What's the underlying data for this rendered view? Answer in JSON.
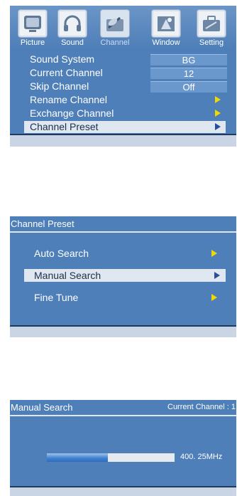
{
  "main_menu": {
    "tabs": [
      {
        "label": "Picture",
        "icon": "tv-icon"
      },
      {
        "label": "Sound",
        "icon": "headphones-icon"
      },
      {
        "label": "Channel",
        "icon": "satellite-dish-icon",
        "active": true
      },
      {
        "label": "Window",
        "icon": "window-icon"
      },
      {
        "label": "Setting",
        "icon": "toolbox-icon"
      }
    ],
    "items": [
      {
        "label": "Sound System",
        "value": "BG"
      },
      {
        "label": "Current Channel",
        "value": "12"
      },
      {
        "label": "Skip Channel",
        "value": "Off"
      },
      {
        "label": "Rename Channel",
        "submenu": true
      },
      {
        "label": "Exchange Channel",
        "submenu": true
      },
      {
        "label": "Channel Preset",
        "submenu": true,
        "selected": true
      }
    ]
  },
  "channel_preset": {
    "title": "Channel Preset",
    "items": [
      {
        "label": "Auto Search"
      },
      {
        "label": "Manual Search",
        "selected": true
      },
      {
        "label": "Fine Tune"
      }
    ]
  },
  "manual_search": {
    "title": "Manual Search",
    "current_channel": "Current Channel : 1",
    "frequency": "400. 25MHz",
    "progress_fraction": 0.48
  },
  "colors": {
    "panel_blue": "#4f7fb8",
    "selection": "#dfe7f1",
    "arrow_yellow": "#f0d800",
    "arrow_selected": "#2a4f9a",
    "footer": "#c9d5e5"
  }
}
